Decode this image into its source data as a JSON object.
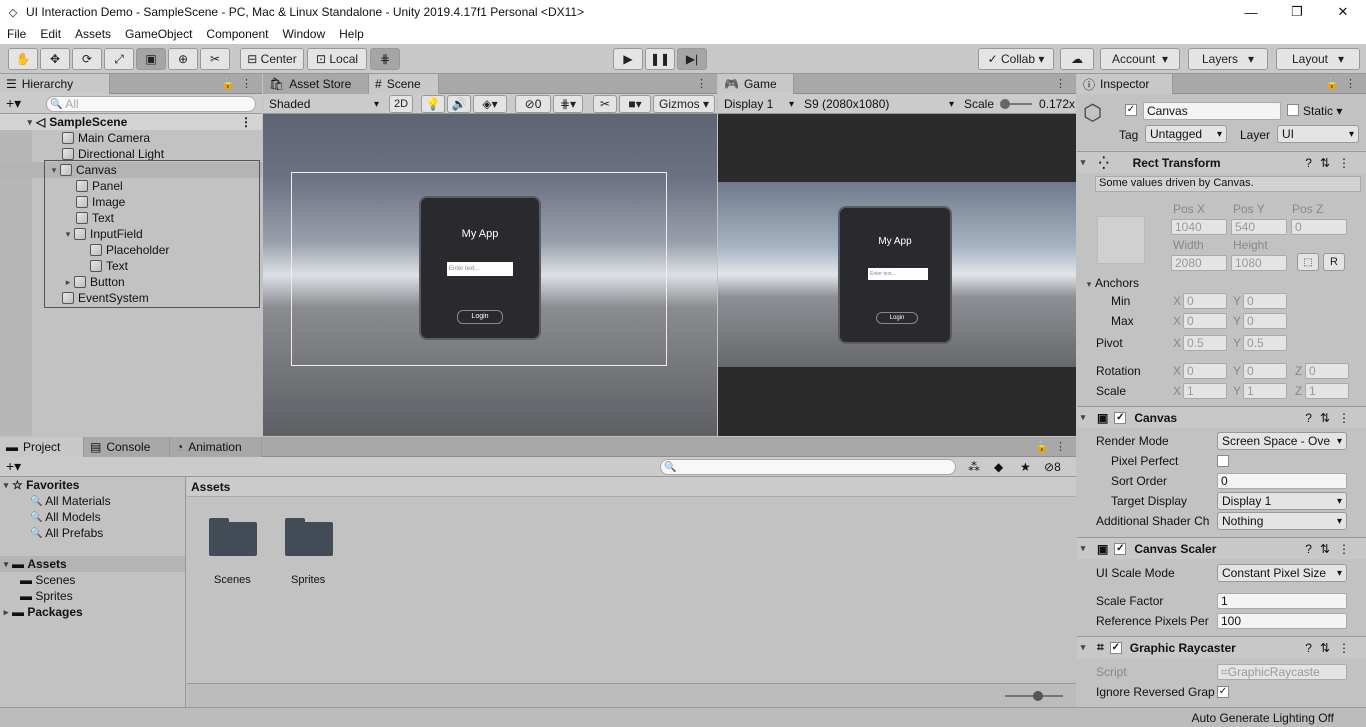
{
  "window": {
    "title": "UI Interaction Demo - SampleScene - PC, Mac & Linux Standalone - Unity 2019.4.17f1 Personal <DX11>"
  },
  "menu": [
    "File",
    "Edit",
    "Assets",
    "GameObject",
    "Component",
    "Window",
    "Help"
  ],
  "toolbar": {
    "center": "Center",
    "local": "Local",
    "collab": "Collab",
    "account": "Account",
    "layers": "Layers",
    "layout": "Layout"
  },
  "hierarchy": {
    "tab": "Hierarchy",
    "search_placeholder": "All",
    "scene": "SampleScene",
    "items": [
      "Main Camera",
      "Directional Light",
      "Canvas",
      "Panel",
      "Image",
      "Text",
      "InputField",
      "Placeholder",
      "Text",
      "Button",
      "EventSystem"
    ]
  },
  "scene": {
    "tabs": {
      "asset_store": "Asset Store",
      "scene": "Scene"
    },
    "shading": "Shaded",
    "mode2d": "2D",
    "hidden_count": "0",
    "gizmos": "Gizmos",
    "app_title": "My App",
    "input_text": "Enter text...",
    "button_label": "Login"
  },
  "game": {
    "tab": "Game",
    "display": "Display 1",
    "resolution": "S9 (2080x1080)",
    "scale_label": "Scale",
    "scale_value": "0.172x",
    "app_title": "My App",
    "input_text": "Enter text...",
    "button_label": "Login"
  },
  "project": {
    "tabs": {
      "project": "Project",
      "console": "Console",
      "animation": "Animation"
    },
    "favorites": {
      "label": "Favorites",
      "items": [
        "All Materials",
        "All Models",
        "All Prefabs"
      ]
    },
    "assets_root": "Assets",
    "asset_folders": [
      "Scenes",
      "Sprites"
    ],
    "packages": "Packages",
    "breadcrumb": "Assets",
    "hidden_count": "8",
    "folders": [
      "Scenes",
      "Sprites"
    ]
  },
  "inspector": {
    "tab": "Inspector",
    "object_name": "Canvas",
    "static_label": "Static",
    "tag_label": "Tag",
    "tag_value": "Untagged",
    "layer_label": "Layer",
    "layer_value": "UI",
    "rect": {
      "title": "Rect Transform",
      "info": "Some values driven by Canvas.",
      "posx_label": "Pos X",
      "posy_label": "Pos Y",
      "posz_label": "Pos Z",
      "posx": "1040",
      "posy": "540",
      "posz": "0",
      "width_label": "Width",
      "height_label": "Height",
      "width": "2080",
      "height": "1080",
      "r_button": "R",
      "anchors": "Anchors",
      "min": "Min",
      "max": "Max",
      "min_x": "0",
      "min_y": "0",
      "max_x": "0",
      "max_y": "0",
      "pivot": "Pivot",
      "pivot_x": "0.5",
      "pivot_y": "0.5",
      "rotation": "Rotation",
      "rot_x": "0",
      "rot_y": "0",
      "rot_z": "0",
      "scale": "Scale",
      "scale_x": "1",
      "scale_y": "1",
      "scale_z": "1",
      "x": "X",
      "y": "Y",
      "z": "Z"
    },
    "canvas": {
      "title": "Canvas",
      "render_mode_label": "Render Mode",
      "render_mode": "Screen Space - Ove",
      "pixel_perfect_label": "Pixel Perfect",
      "sort_order_label": "Sort Order",
      "sort_order": "0",
      "target_display_label": "Target Display",
      "target_display": "Display 1",
      "shader_ch_label": "Additional Shader Ch",
      "shader_ch": "Nothing"
    },
    "scaler": {
      "title": "Canvas Scaler",
      "ui_scale_mode_label": "UI Scale Mode",
      "ui_scale_mode": "Constant Pixel Size",
      "scale_factor_label": "Scale Factor",
      "scale_factor": "1",
      "ref_pixels_label": "Reference Pixels Per",
      "ref_pixels": "100"
    },
    "raycaster": {
      "title": "Graphic Raycaster",
      "script_label": "Script",
      "script_value": "GraphicRaycaste",
      "ignore_label": "Ignore Reversed Grap"
    }
  },
  "status": {
    "text": "Auto Generate Lighting Off"
  }
}
